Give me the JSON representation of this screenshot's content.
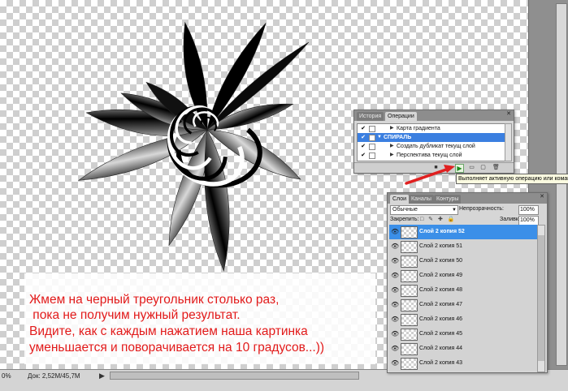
{
  "status": {
    "zoom": "0%",
    "doc": "Док: 2,52M/45,7M",
    "play": "▶"
  },
  "caption": {
    "line1": "Жмем на черный треугольник столько раз,",
    "line2": " пока не получим нужный результат.",
    "line3": "Видите, как с каждым нажатием наша картинка",
    "line4": "уменьшается и поворачивается на 10 градусов...))"
  },
  "actions_panel": {
    "tabs": [
      "История",
      "Операции"
    ],
    "active_tab": "Операции",
    "close": "✕",
    "rows": [
      {
        "label": "Карта градиента",
        "check": "✔",
        "selected": false
      },
      {
        "label": "СПИРАЛЬ",
        "check": "✔",
        "selected": true
      },
      {
        "label": "Создать дубликат текущ слой",
        "check": "✔",
        "selected": false
      },
      {
        "label": "Перспектива текущ слой",
        "check": "✔",
        "selected": false
      }
    ],
    "play_symbol": "▶"
  },
  "tooltip": "Выполняет активную операцию или коман",
  "layers_panel": {
    "tabs": [
      "Слои",
      "Каналы",
      "Контуры"
    ],
    "active_tab": "Слои",
    "close": "✕",
    "blend_mode": "Обычные",
    "opacity_label": "Непрозрачность:",
    "opacity_value": "100%",
    "lock_label": "Закрепить:",
    "lock_icons": "□ ✎ ✚ 🔒",
    "fill_label": "Заливка:",
    "fill_value": "100%",
    "layers": [
      {
        "name": "Слой 2 копия 52",
        "selected": true
      },
      {
        "name": "Слой 2 копия 51",
        "selected": false
      },
      {
        "name": "Слой 2 копия 50",
        "selected": false
      },
      {
        "name": "Слой 2 копия 49",
        "selected": false
      },
      {
        "name": "Слой 2 копия 48",
        "selected": false
      },
      {
        "name": "Слой 2 копия 47",
        "selected": false
      },
      {
        "name": "Слой 2 копия 46",
        "selected": false
      },
      {
        "name": "Слой 2 копия 45",
        "selected": false
      },
      {
        "name": "Слой 2 копия 44",
        "selected": false
      },
      {
        "name": "Слой 2 копия 43",
        "selected": false
      }
    ]
  },
  "colors": {
    "accent": "#3b8fe8",
    "caption_text": "#e21a1a",
    "arrow": "#e02020"
  }
}
